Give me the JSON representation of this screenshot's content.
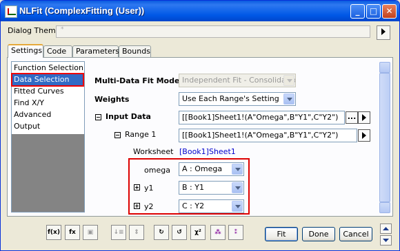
{
  "window": {
    "title": "NLFit (ComplexFitting (User))"
  },
  "theme": {
    "label": "Dialog Theme",
    "value": "*"
  },
  "tabs": [
    "Settings",
    "Code",
    "Parameters",
    "Bounds"
  ],
  "nav": [
    "Function Selection",
    "Data Selection",
    "Fitted Curves",
    "Find X/Y",
    "Advanced",
    "Output"
  ],
  "form": {
    "mode_label": "Multi-Data Fit Mode",
    "mode_value": "Independent Fit - Consolidated Report",
    "weights_label": "Weights",
    "weights_value": "Use Each Range's Setting",
    "input_label": "Input Data",
    "input_value": "[[Book1]Sheet1!(A\"Omega\",B\"Y1\",C\"Y2\")",
    "input_browse": "...",
    "range_label": "Range 1",
    "range_value": "[[Book1]Sheet1!(A\"Omega\",B\"Y1\",C\"Y2\")",
    "worksheet_label": "Worksheet",
    "worksheet_value": "[Book1]Sheet1",
    "omega_label": "omega",
    "omega_value": "A : Omega",
    "y1_label": "y1",
    "y1_value": "B : Y1",
    "y2_label": "y2",
    "y2_value": "C : Y2"
  },
  "toolbar_icons": [
    "fx-icon",
    "fx-table-icon",
    "save-icon",
    "sort-icon",
    "expand-icon",
    "iterate-icon",
    "fit-until-converge-icon",
    "chi-square-icon",
    "params-icon",
    "params-all-icon"
  ],
  "buttons": {
    "fit": "Fit",
    "done": "Done",
    "cancel": "Cancel"
  },
  "colors": {
    "selection": "#316ac5",
    "highlight_border": "#dd0000",
    "link": "#0000cc"
  }
}
